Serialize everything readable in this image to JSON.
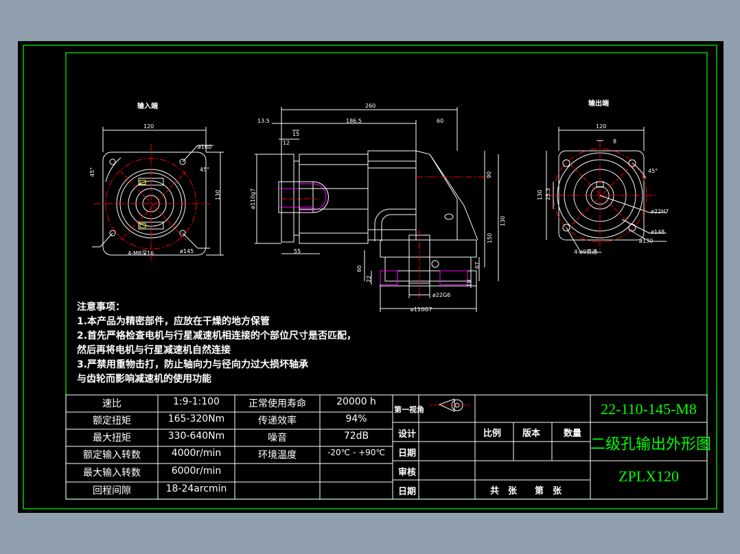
{
  "views": {
    "input_end": "输入端",
    "output_end": "输出端"
  },
  "dims": {
    "d260": "260",
    "d13_5": "13.5",
    "d186_5": "186.5",
    "d60": "60",
    "d15": "15",
    "d12": "12",
    "d110_side": "ø110g7",
    "d55": "55",
    "d90": "90",
    "d130": "130",
    "d150": "150",
    "d67": "67",
    "d60b": "60",
    "d22": "22",
    "d10": "10",
    "d22_shaft": "ø22G6",
    "d110_bottom": "ø110G7",
    "in_120": "120",
    "in_160": "ø160",
    "in_45": "45°",
    "in_45b": "45°",
    "in_130": "130",
    "in_145": "ø145",
    "in_holes": "4-M8深16",
    "out_120": "120",
    "out_8": "8",
    "out_130": "130",
    "out_25_3": "25.3",
    "out_45": "45°",
    "out_22": "ø22H7",
    "out_148": "ø148",
    "out_130b": "ø130",
    "out_holes": "4-ø9贯通"
  },
  "notes": {
    "title": "注意事项：",
    "n1": "1.本产品为精密部件，应放在干燥的地方保管",
    "n2": "2.首先严格检查电机与行星减速机相连接的个部位尺寸是否匹配，",
    "n2b": "然后再将电机与行星减速机自然连接",
    "n3": "3.严禁用重物击打，防止轴向力与径向力过大损坏轴承",
    "n3b": "与齿轮而影响减速机的使用功能"
  },
  "specs": [
    {
      "label": "速比",
      "value": "1:9-1:100",
      "label2": "正常使用寿命",
      "value2": "20000 h"
    },
    {
      "label": "额定扭矩",
      "value": "165-320Nm",
      "label2": "传递效率",
      "value2": "94%"
    },
    {
      "label": "最大扭矩",
      "value": "330-640Nm",
      "label2": "噪音",
      "value2": "72dB"
    },
    {
      "label": "额定输入转数",
      "value": "4000r/min",
      "label2": "环境温度",
      "value2": "-20℃ - +90℃"
    },
    {
      "label": "最大输入转数",
      "value": "6000r/min",
      "label2": "",
      "value2": ""
    },
    {
      "label": "回程间隙",
      "value": "18-24arcmin",
      "label2": "",
      "value2": ""
    }
  ],
  "title_block": {
    "projection": "第一视角",
    "design": "设计",
    "date1": "日期",
    "review": "审核",
    "date2": "日期",
    "scale": "比例",
    "version": "版本",
    "quantity": "数量",
    "sheets": "共　张　　第　张",
    "drawing_no": "22-110-145-M8",
    "drawing_name": "二级孔输出外形图",
    "model": "ZPLX120"
  },
  "colors": {
    "frame": "#00ff00",
    "line": "#ffffff",
    "center": "#ff0000",
    "hatch": "#ff00ff",
    "text_green": "#00ff00"
  }
}
